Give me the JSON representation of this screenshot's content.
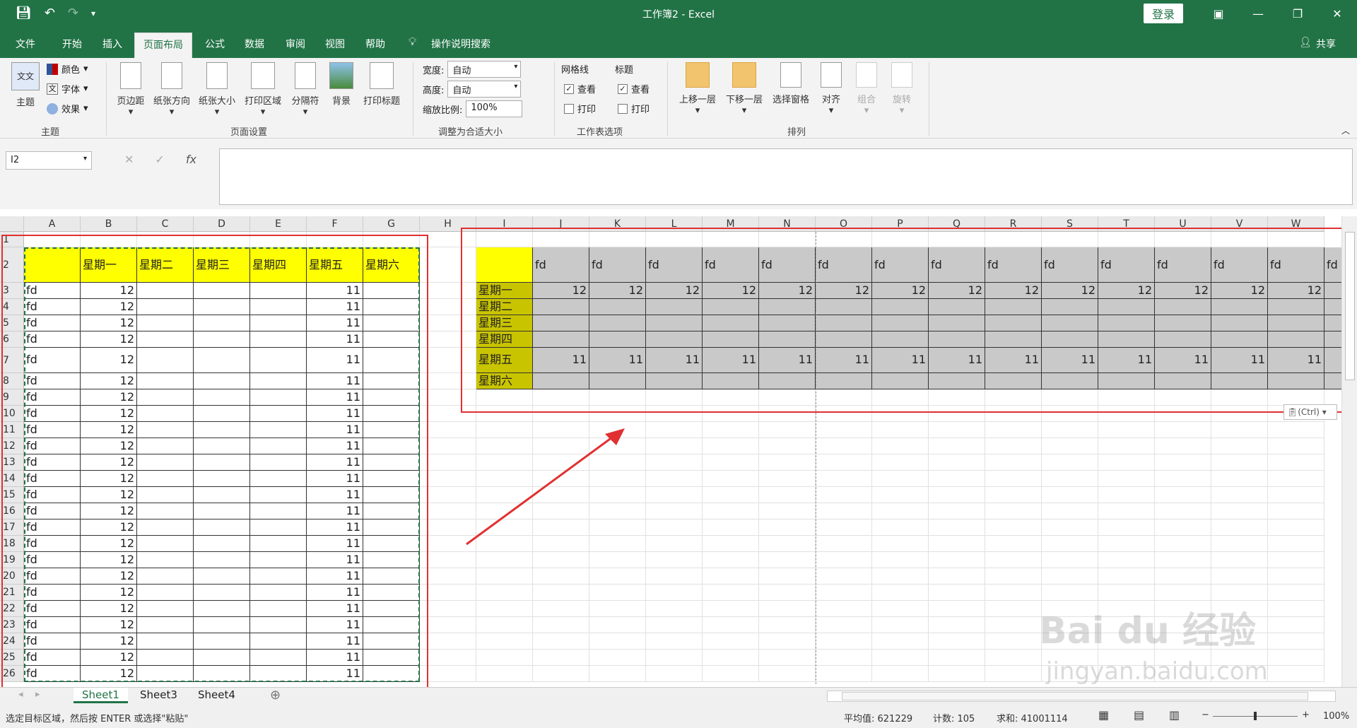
{
  "window": {
    "title": "工作簿2  -  Excel",
    "login_label": "登录"
  },
  "icons": {
    "save": "save-icon",
    "undo": "undo-icon",
    "redo": "redo-icon",
    "customize": "customize-icon",
    "ribbon_display": "ribbon-display-icon",
    "minimize": "minimize-icon",
    "restore": "restore-icon",
    "close": "close-icon",
    "lightbulb": "lightbulb-icon",
    "user": "user-icon",
    "cancel": "cancel-icon",
    "enter": "enter-icon",
    "function": "function-icon",
    "dropdown": "chevron-down-icon",
    "add_sheet": "add-sheet-icon",
    "paste_options": "paste-icon",
    "normal_view": "normal-view-icon",
    "page_layout_view": "page-layout-view-icon",
    "page_break_view": "page-break-view-icon"
  },
  "glyphs": {
    "cancel": "✕",
    "enter": "✓",
    "function": "fx",
    "add_sheet": "⊕",
    "minus": "−",
    "plus": "+"
  },
  "menu": {
    "tabs": [
      "文件",
      "开始",
      "插入",
      "页面布局",
      "公式",
      "数据",
      "审阅",
      "视图",
      "帮助"
    ],
    "active_tab": "页面布局",
    "tell_me": "操作说明搜索",
    "share": "共享"
  },
  "ribbon": {
    "theme": {
      "themes": "主题",
      "colors": "颜色",
      "fonts": "字体",
      "effects": "效果",
      "group": "主题"
    },
    "page_setup": {
      "margins": "页边距",
      "orientation": "纸张方向",
      "size": "纸张大小",
      "print_area": "打印区域",
      "breaks": "分隔符",
      "background": "背景",
      "print_titles": "打印标题",
      "group": "页面设置"
    },
    "scale": {
      "width_label": "宽度:",
      "width_value": "自动",
      "height_label": "高度:",
      "height_value": "自动",
      "scale_label": "缩放比例:",
      "scale_value": "100%",
      "group": "调整为合适大小"
    },
    "sheet_options": {
      "gridlines": "网格线",
      "headings": "标题",
      "view": "查看",
      "print": "打印",
      "gridlines_view": true,
      "gridlines_print": false,
      "headings_view": true,
      "headings_print": false,
      "group": "工作表选项"
    },
    "arrange": {
      "bring_forward": "上移一层",
      "send_backward": "下移一层",
      "selection_pane": "选择窗格",
      "align": "对齐",
      "group_btn": "组合",
      "rotate": "旋转",
      "group": "排列"
    }
  },
  "formula_bar": {
    "name_box": "I2",
    "formula": ""
  },
  "grid": {
    "column_headers": [
      "A",
      "B",
      "C",
      "D",
      "E",
      "F",
      "G",
      "H",
      "I",
      "J",
      "K",
      "L",
      "M",
      "N",
      "O",
      "P",
      "Q",
      "R",
      "S",
      "T",
      "U",
      "V",
      "W"
    ],
    "row_numbers": [
      "1",
      "2",
      "3",
      "4",
      "5",
      "6",
      "7",
      "8",
      "9",
      "10",
      "11",
      "12",
      "13",
      "14",
      "15",
      "16",
      "17",
      "18",
      "19",
      "20",
      "21",
      "22",
      "23",
      "24",
      "25",
      "26"
    ],
    "source_header": [
      "",
      "星期一",
      "星期二",
      "星期三",
      "星期四",
      "星期五",
      "星期六"
    ],
    "source_row": {
      "label": "fd",
      "b": "12",
      "f": "11"
    },
    "source_row_count": 24,
    "transposed_row_labels": [
      "星期一",
      "星期二",
      "星期三",
      "星期四",
      "星期五",
      "星期六"
    ],
    "transposed_header": "fd",
    "transposed_values": {
      "星期一": "12",
      "星期五": "11"
    },
    "transposed_col_count": 15,
    "paste_options_label": "(Ctrl)"
  },
  "sheet_tabs": {
    "tabs": [
      "Sheet1",
      "Sheet3",
      "Sheet4"
    ],
    "active": "Sheet1"
  },
  "status": {
    "message": "选定目标区域，然后按 ENTER 或选择\"粘贴\"",
    "average": "平均值: 621229",
    "count": "计数: 105",
    "sum": "求和: 41001114",
    "zoom": "100%"
  },
  "watermark": {
    "brand": "Bai du 经验",
    "url": "jingyan.baidu.com"
  },
  "colors": {
    "excel_green": "#217346",
    "highlight_yellow": "#ffff00",
    "olive": "#c9c400",
    "grey_fill": "#c9c9c9",
    "red_box": "#e03030"
  }
}
